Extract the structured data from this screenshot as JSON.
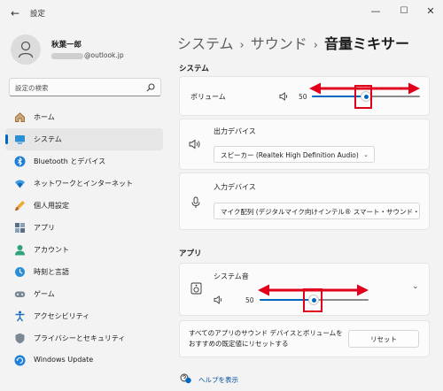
{
  "window": {
    "back_glyph": "←",
    "title": "設定",
    "controls": {
      "minimize": "—",
      "maximize": "☐",
      "close": "✕"
    }
  },
  "profile": {
    "name": "秋葉一郎",
    "email_suffix": "@outlook.jp",
    "avatar_icon": "person-icon"
  },
  "search": {
    "placeholder": "設定の検索",
    "icon": "search-icon"
  },
  "sidebar": {
    "items": [
      {
        "label": "ホーム",
        "icon": "home-icon",
        "active": false
      },
      {
        "label": "システム",
        "icon": "system-icon",
        "active": true
      },
      {
        "label": "Bluetooth とデバイス",
        "icon": "bluetooth-icon",
        "active": false
      },
      {
        "label": "ネットワークとインターネット",
        "icon": "network-icon",
        "active": false
      },
      {
        "label": "個人用設定",
        "icon": "personalization-icon",
        "active": false
      },
      {
        "label": "アプリ",
        "icon": "apps-icon",
        "active": false
      },
      {
        "label": "アカウント",
        "icon": "account-icon",
        "active": false
      },
      {
        "label": "時刻と言語",
        "icon": "time-language-icon",
        "active": false
      },
      {
        "label": "ゲーム",
        "icon": "gaming-icon",
        "active": false
      },
      {
        "label": "アクセシビリティ",
        "icon": "accessibility-icon",
        "active": false
      },
      {
        "label": "プライバシーとセキュリティ",
        "icon": "privacy-icon",
        "active": false
      },
      {
        "label": "Windows Update",
        "icon": "windows-update-icon",
        "active": false
      }
    ]
  },
  "breadcrumb": {
    "level1": "システム",
    "separator": "›",
    "level2": "サウンド",
    "level3": "音量ミキサー"
  },
  "system_section": {
    "heading": "システム",
    "volume": {
      "label": "ボリューム",
      "value": "50",
      "level": 0.5
    },
    "output_device": {
      "label": "出力デバイス",
      "selected": "スピーカー (Realtek High Definition Audio)"
    },
    "input_device": {
      "label": "入力デバイス",
      "selected": "マイク配列 (デジタルマイク向けインテル® スマート・サウンド・テ"
    }
  },
  "apps_section": {
    "heading": "アプリ",
    "system_sounds": {
      "label": "システム音",
      "value": "50",
      "level": 0.5
    },
    "reset_text": "すべてのアプリのサウンド デバイスとボリュームをおすすめの既定値にリセットする",
    "reset_button": "リセット"
  },
  "help": {
    "label": "ヘルプを表示"
  },
  "colors": {
    "accent": "#0067c0",
    "annotation_red": "#e0001b",
    "background": "#f3f3f3",
    "card": "#fbfbfb"
  }
}
